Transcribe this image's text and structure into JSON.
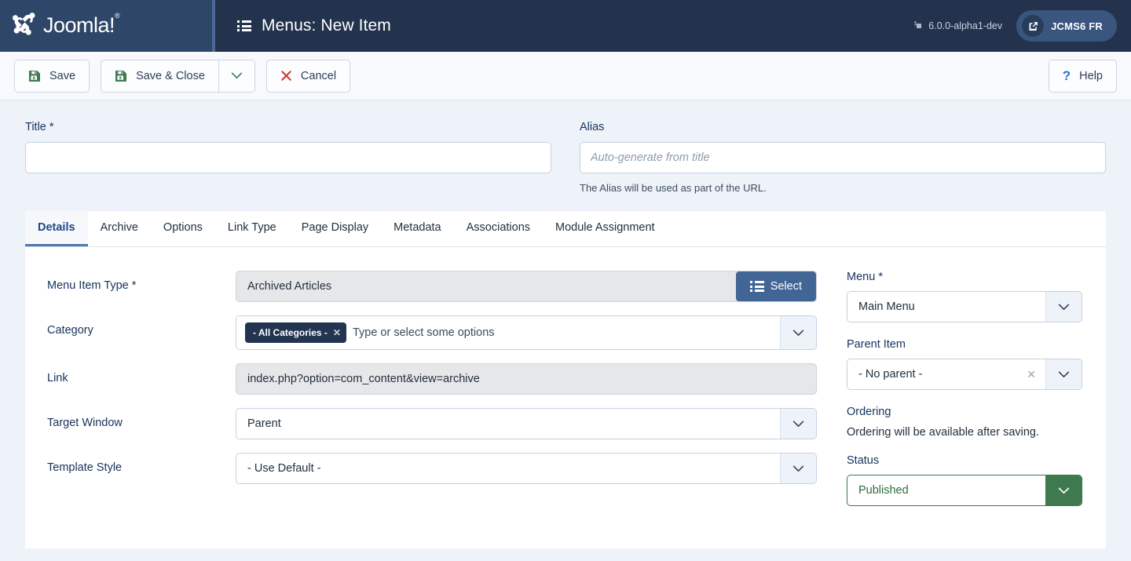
{
  "header": {
    "brand": "Joomla!",
    "brand_sup": "®",
    "page_title": "Menus: New Item",
    "page_title_icon": "list-icon",
    "version": "6.0.0-alpha1-dev",
    "site_link_label": "JCMS6 FR",
    "site_link_icon": "external-link-icon"
  },
  "toolbar": {
    "save_label": "Save",
    "save_icon": "floppy-disk-icon",
    "save_close_label": "Save & Close",
    "save_close_icon": "floppy-disk-icon",
    "save_dropdown_icon": "chevron-down-icon",
    "cancel_label": "Cancel",
    "cancel_icon": "x-icon",
    "help_label": "Help",
    "help_icon": "question-mark-icon"
  },
  "form_top": {
    "title_label": "Title",
    "title_required": "*",
    "title_value": "",
    "title_placeholder": "",
    "alias_label": "Alias",
    "alias_value": "",
    "alias_placeholder": "Auto-generate from title",
    "alias_help": "The Alias will be used as part of the URL."
  },
  "tabs": [
    {
      "label": "Details",
      "active": true
    },
    {
      "label": "Archive",
      "active": false
    },
    {
      "label": "Options",
      "active": false
    },
    {
      "label": "Link Type",
      "active": false
    },
    {
      "label": "Page Display",
      "active": false
    },
    {
      "label": "Metadata",
      "active": false
    },
    {
      "label": "Associations",
      "active": false
    },
    {
      "label": "Module Assignment",
      "active": false
    }
  ],
  "details": {
    "menu_item_type_label": "Menu Item Type",
    "menu_item_type_required": "*",
    "menu_item_type_value": "Archived Articles",
    "select_button_label": "Select",
    "select_button_icon": "list-icon",
    "category_label": "Category",
    "category_chip": "- All Categories -",
    "category_chip_remove_icon": "x-icon",
    "category_placeholder": "Type or select some options",
    "link_label": "Link",
    "link_value": "index.php?option=com_content&view=archive",
    "target_window_label": "Target Window",
    "target_window_value": "Parent",
    "template_style_label": "Template Style",
    "template_style_value": "- Use Default -"
  },
  "sidebar": {
    "menu_label": "Menu",
    "menu_required": "*",
    "menu_value": "Main Menu",
    "parent_item_label": "Parent Item",
    "parent_item_value": "- No parent -",
    "parent_item_clear_icon": "x-icon",
    "ordering_label": "Ordering",
    "ordering_note": "Ordering will be available after saving.",
    "status_label": "Status",
    "status_value": "Published"
  },
  "colors": {
    "header_bg": "#23334d",
    "header_logo_bg": "#2e4667",
    "page_bg": "#eef2f9",
    "accent_blue": "#416595",
    "label_navy": "#16325c",
    "save_green": "#3f7a4e",
    "cancel_red": "#c8352f",
    "help_blue": "#2f6fd0",
    "chip_navy": "#22344f",
    "tab_active_underline": "#4d77ad"
  }
}
